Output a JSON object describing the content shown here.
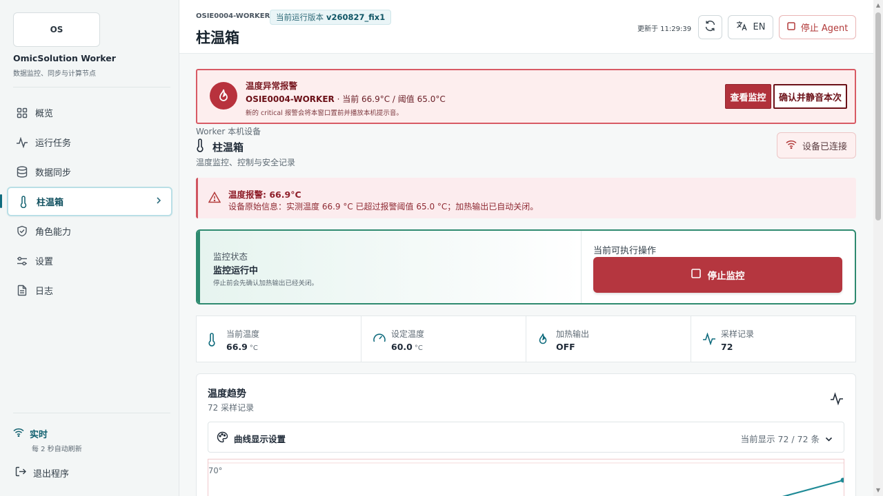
{
  "sidebar": {
    "logo_text": "OS",
    "app_name": "OmicSolution Worker",
    "app_sub": "数据监控、同步与计算节点",
    "items": [
      {
        "label": "概览",
        "icon": "grid-icon"
      },
      {
        "label": "运行任务",
        "icon": "activity-icon"
      },
      {
        "label": "数据同步",
        "icon": "database-icon"
      },
      {
        "label": "柱温箱",
        "icon": "thermometer-icon"
      },
      {
        "label": "角色能力",
        "icon": "shield-check-icon"
      },
      {
        "label": "设置",
        "icon": "sliders-icon"
      },
      {
        "label": "日志",
        "icon": "file-text-icon"
      }
    ],
    "live_title": "实时",
    "live_sub": "每 2 秒自动刷新",
    "exit_label": "退出程序"
  },
  "header": {
    "worker_id": "OSIE0004-WORKER",
    "version_prefix": "当前运行版本",
    "version": "v260827_fix1",
    "title": "柱温箱",
    "updated": "更新于 11:29:39",
    "lang_label": "EN",
    "stop_agent_label": "停止 Agent"
  },
  "alarm": {
    "title": "温度异常报警",
    "worker": "OSIE0004-WORKER",
    "detail": " · 当前 66.9°C / 阈值 65.0°C",
    "note": "新的 critical 报警会将本窗口置前并播放本机提示音。",
    "view_label": "查看监控",
    "ack_label": "确认并静音本次"
  },
  "device": {
    "section_label": "Worker 本机设备",
    "name": "柱温箱",
    "desc": "温度监控、控制与安全记录",
    "connected_label": "设备已连接"
  },
  "warning": {
    "title": "温度报警: 66.9°C",
    "text": "设备原始信息：实测温度 66.9 °C 已超过报警阈值 65.0 °C；加热输出已自动关闭。"
  },
  "monitor": {
    "status_label": "监控状态",
    "status_value": "监控运行中",
    "note": "停止前会先确认加热输出已经关闭。",
    "actions_label": "当前可执行操作",
    "stop_label": "停止监控"
  },
  "stats": [
    {
      "label": "当前温度",
      "value": "66.9",
      "unit": "°C",
      "icon": "thermometer-icon"
    },
    {
      "label": "设定温度",
      "value": "60.0",
      "unit": "°C",
      "icon": "gauge-icon"
    },
    {
      "label": "加热输出",
      "value": "OFF",
      "unit": "",
      "icon": "flame-icon"
    },
    {
      "label": "采样记录",
      "value": "72",
      "unit": "",
      "icon": "activity-icon"
    }
  ],
  "trend": {
    "title": "温度趋势",
    "sub": "72 采样记录",
    "settings_label": "曲线显示设置",
    "display_count": "当前显示 72 / 72 条",
    "y_top_tick": "70°"
  },
  "colors": {
    "accent": "#0f6b7d",
    "danger": "#b5363f",
    "success": "#2e8a6f",
    "line": "#1e8a96"
  }
}
